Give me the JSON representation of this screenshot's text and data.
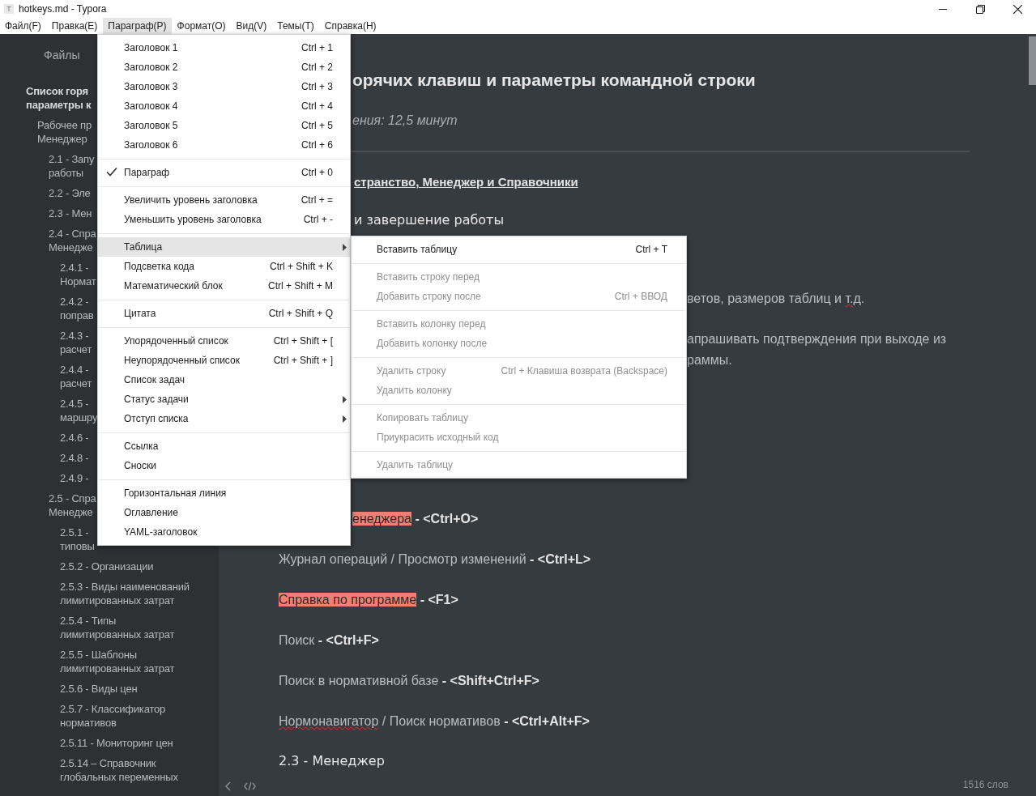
{
  "window": {
    "icon_letter": "T",
    "title": "hotkeys.md - Typora"
  },
  "menubar": [
    {
      "label": "Файл(F)",
      "selected": false
    },
    {
      "label": "Правка(E)",
      "selected": false
    },
    {
      "label": "Параграф(P)",
      "selected": true
    },
    {
      "label": "Формат(O)",
      "selected": false
    },
    {
      "label": "Вид(V)",
      "selected": false
    },
    {
      "label": "Темы(T)",
      "selected": false
    },
    {
      "label": "Справка(H)",
      "selected": false
    }
  ],
  "sidebar": {
    "tab": "Файлы",
    "outline": [
      {
        "text": "Список горя\nпараметры к",
        "children": [
          {
            "text": "Рабочее пр\nМенеджер",
            "children": [
              {
                "text": "2.1 - Запу\nработы"
              },
              {
                "text": "2.2 - Эле"
              },
              {
                "text": "2.3 - Мен"
              },
              {
                "text": "2.4 - Спра\nМенедже",
                "children": [
                  {
                    "text": "2.4.1 -\nНормат"
                  },
                  {
                    "text": "2.4.2 -\nпоправ"
                  },
                  {
                    "text": "2.4.3 -\nрасчет"
                  },
                  {
                    "text": "2.4.4 -\nрасчет"
                  },
                  {
                    "text": "2.4.5 -\nмаршру"
                  },
                  {
                    "text": "2.4.6 -"
                  },
                  {
                    "text": "2.4.8 -"
                  },
                  {
                    "text": "2.4.9 -"
                  }
                ]
              },
              {
                "text": "2.5 - Спра\nМенедже",
                "children": [
                  {
                    "text": "2.5.1 -\nтиповы"
                  },
                  {
                    "text": "2.5.2 - Организации"
                  },
                  {
                    "text": "2.5.3 - Виды наименований лимитированных затрат"
                  },
                  {
                    "text": "2.5.4 - Типы лимитированных затрат"
                  },
                  {
                    "text": "2.5.5 - Шаблоны лимитированных затрат"
                  },
                  {
                    "text": "2.5.6 - Виды цен"
                  },
                  {
                    "text": "2.5.7 - Классификатор нормативов"
                  },
                  {
                    "text": "2.5.11 - Мониторинг цен"
                  },
                  {
                    "text": "2.5.14 – Справочник глобальных переменных"
                  }
                ]
              }
            ]
          }
        ]
      }
    ]
  },
  "document": [
    {
      "kind": "title",
      "text": "орячих клавиш и параметры командной строки"
    },
    {
      "kind": "subtitle",
      "text": "ения: 12,5 минут"
    },
    {
      "kind": "rule"
    },
    {
      "kind": "link_heading",
      "text": "странство, Менеджер и Справочники"
    },
    {
      "kind": "heading",
      "text": "и завершение работы"
    },
    {
      "kind": "para",
      "parts": [
        {
          "text": "ветов, размеров таблиц и ",
          "highlight": false,
          "misspelled": false
        },
        {
          "text": "т.д",
          "highlight": false,
          "misspelled": true
        },
        {
          "text": ".",
          "highlight": false,
          "misspelled": false
        }
      ]
    },
    {
      "kind": "para",
      "parts": [
        {
          "text": "апрашивать подтверждения при выходе из",
          "highlight": false,
          "misspelled": false
        }
      ]
    },
    {
      "kind": "para",
      "parts": [
        {
          "text": "раммы.",
          "highlight": false,
          "misspelled": false
        }
      ]
    },
    {
      "kind": "para",
      "parts": [
        {
          "text": "енеджера",
          "highlight": true,
          "misspelled": false
        },
        {
          "text": " **- <Ctrl+O>**",
          "highlight": false,
          "misspelled": false
        }
      ]
    },
    {
      "kind": "para",
      "parts": [
        {
          "text": "Журнал операций / Просмотр изменений **- <Ctrl+L>**",
          "highlight": false,
          "misspelled": false
        }
      ]
    },
    {
      "kind": "para",
      "parts": [
        {
          "text": "Справка по программе",
          "highlight": true,
          "misspelled": false
        },
        {
          "text": " **- <F1>**",
          "highlight": false,
          "misspelled": false
        }
      ]
    },
    {
      "kind": "para",
      "parts": [
        {
          "text": "Поиск **- <Ctrl+F>**",
          "highlight": false,
          "misspelled": false
        }
      ]
    },
    {
      "kind": "para",
      "parts": [
        {
          "text": "Поиск в нормативной базе **- <Shift+Ctrl+F>**",
          "highlight": false,
          "misspelled": false
        }
      ]
    },
    {
      "kind": "para",
      "parts": [
        {
          "text": "Нормонавигатор",
          "highlight": false,
          "misspelled": true
        },
        {
          "text": " / Поиск нормативов **- <Ctrl+Alt+F>**",
          "highlight": false,
          "misspelled": false
        }
      ]
    },
    {
      "kind": "heading",
      "text": "2.3 - Менеджер"
    }
  ],
  "footer": {
    "word_count": "1516 слов"
  },
  "menu": {
    "groups": [
      [
        {
          "label": "Заголовок 1",
          "shortcut": "Ctrl + 1",
          "checked": false,
          "submenu": false,
          "selected": false
        },
        {
          "label": "Заголовок 2",
          "shortcut": "Ctrl + 2",
          "checked": false,
          "submenu": false,
          "selected": false
        },
        {
          "label": "Заголовок 3",
          "shortcut": "Ctrl + 3",
          "checked": false,
          "submenu": false,
          "selected": false
        },
        {
          "label": "Заголовок 4",
          "shortcut": "Ctrl + 4",
          "checked": false,
          "submenu": false,
          "selected": false
        },
        {
          "label": "Заголовок 5",
          "shortcut": "Ctrl + 5",
          "checked": false,
          "submenu": false,
          "selected": false
        },
        {
          "label": "Заголовок 6",
          "shortcut": "Ctrl + 6",
          "checked": false,
          "submenu": false,
          "selected": false
        }
      ],
      [
        {
          "label": "Параграф",
          "shortcut": "Ctrl + 0",
          "checked": true,
          "submenu": false,
          "selected": false
        }
      ],
      [
        {
          "label": "Увеличить уровень заголовка",
          "shortcut": "Ctrl + =",
          "checked": false,
          "submenu": false,
          "selected": false
        },
        {
          "label": "Уменьшить уровень заголовка",
          "shortcut": "Ctrl + -",
          "checked": false,
          "submenu": false,
          "selected": false
        }
      ],
      [
        {
          "label": "Таблица",
          "checked": false,
          "submenu": true,
          "selected": true
        },
        {
          "label": "Подсветка кода",
          "shortcut": "Ctrl + Shift + K",
          "checked": false,
          "submenu": false,
          "selected": false
        },
        {
          "label": "Математический блок",
          "shortcut": "Ctrl + Shift + M",
          "checked": false,
          "submenu": false,
          "selected": false
        }
      ],
      [
        {
          "label": "Цитата",
          "shortcut": "Ctrl + Shift + Q",
          "checked": false,
          "submenu": false,
          "selected": false
        }
      ],
      [
        {
          "label": "Упорядоченный список",
          "shortcut": "Ctrl + Shift + [",
          "checked": false,
          "submenu": false,
          "selected": false
        },
        {
          "label": "Неупорядоченный список",
          "shortcut": "Ctrl + Shift + ]",
          "checked": false,
          "submenu": false,
          "selected": false
        },
        {
          "label": "Список задач",
          "checked": false,
          "submenu": false,
          "selected": false
        },
        {
          "label": "Статус задачи",
          "checked": false,
          "submenu": true,
          "selected": false
        },
        {
          "label": "Отступ списка",
          "checked": false,
          "submenu": true,
          "selected": false
        }
      ],
      [
        {
          "label": "Ссылка",
          "checked": false,
          "submenu": false,
          "selected": false
        },
        {
          "label": "Сноски",
          "checked": false,
          "submenu": false,
          "selected": false
        }
      ],
      [
        {
          "label": "Горизонтальная линия",
          "checked": false,
          "submenu": false,
          "selected": false
        },
        {
          "label": "Оглавление",
          "checked": false,
          "submenu": false,
          "selected": false
        },
        {
          "label": "YAML-заголовок",
          "checked": false,
          "submenu": false,
          "selected": false
        }
      ]
    ]
  },
  "submenu": {
    "groups": [
      [
        {
          "label": "Вставить таблицу",
          "shortcut": "Ctrl + T",
          "disabled": false
        }
      ],
      [
        {
          "label": "Вставить строку перед",
          "disabled": true
        },
        {
          "label": "Добавить строку после",
          "shortcut": "Ctrl + ВВОД",
          "disabled": true
        }
      ],
      [
        {
          "label": "Вставить колонку перед",
          "disabled": true
        },
        {
          "label": "Добавить колонку после",
          "disabled": true
        }
      ],
      [
        {
          "label": "Удалить строку",
          "shortcut": "Ctrl + Клавиша возврата (Backspace)",
          "disabled": true
        },
        {
          "label": "Удалить колонку",
          "disabled": true
        }
      ],
      [
        {
          "label": "Копировать таблицу",
          "disabled": true
        },
        {
          "label": "Приукрасить исходный код",
          "disabled": true
        }
      ],
      [
        {
          "label": "Удалить таблицу",
          "disabled": true
        }
      ]
    ]
  }
}
